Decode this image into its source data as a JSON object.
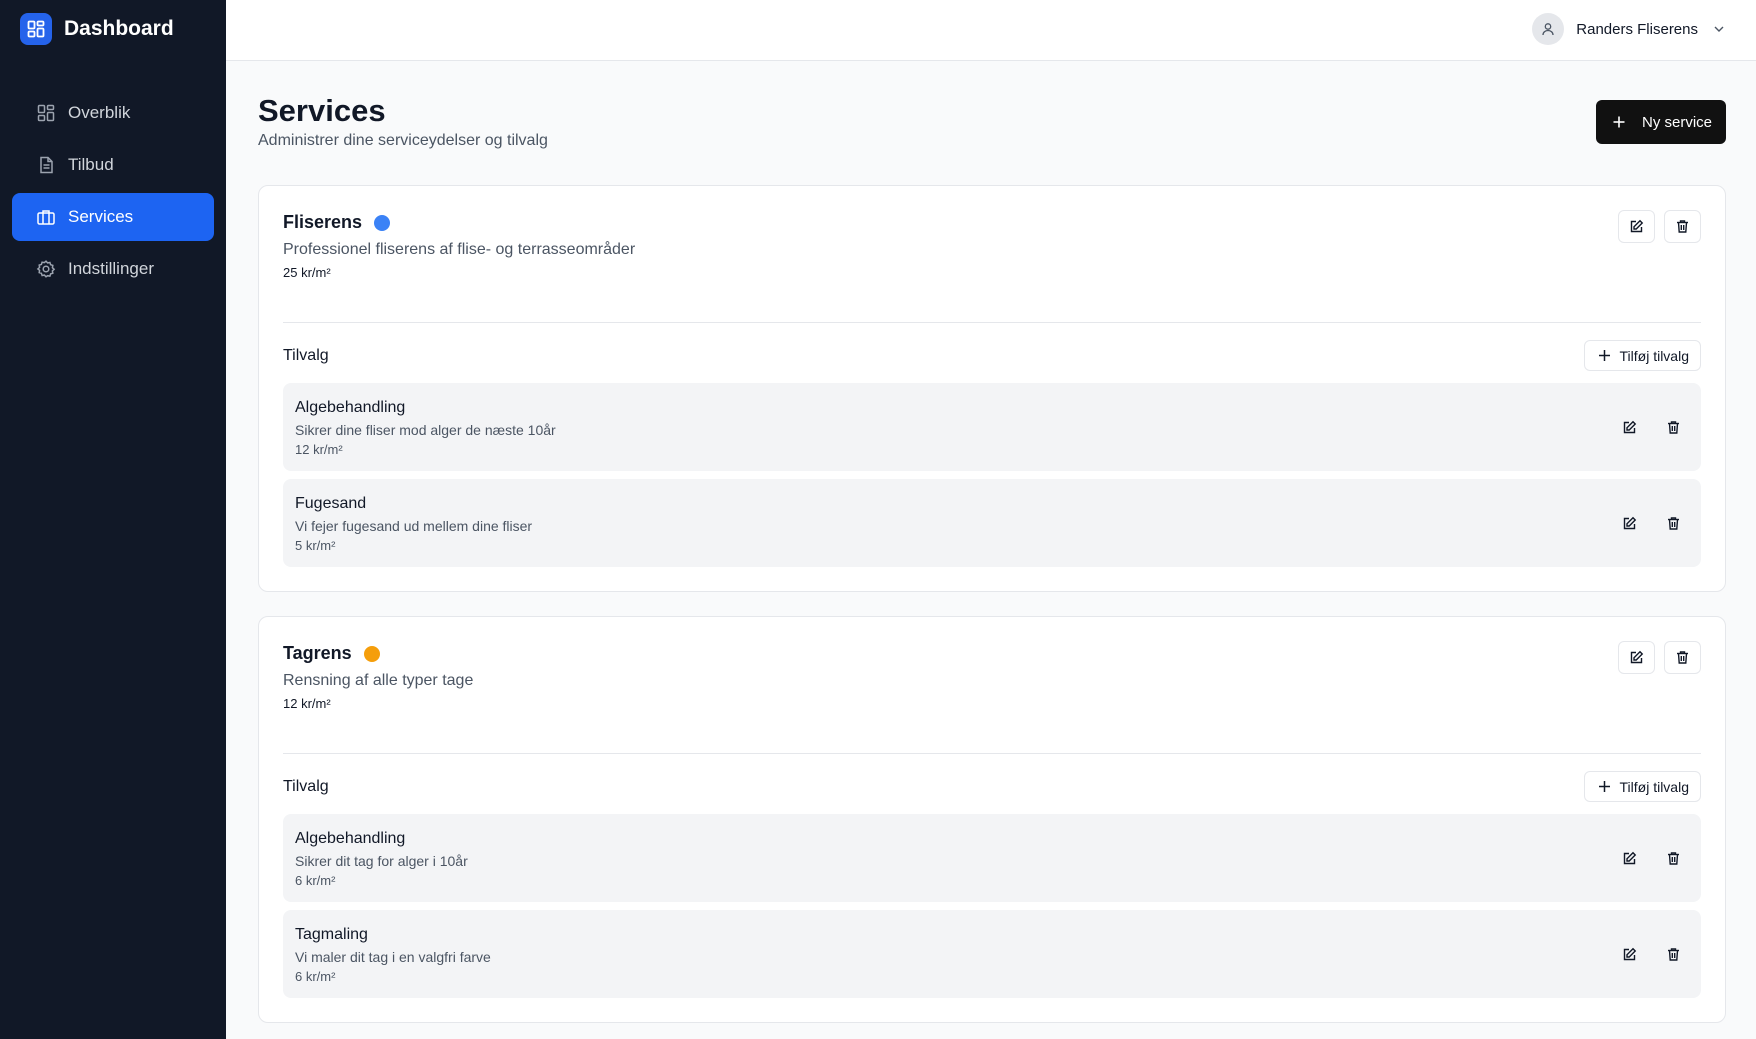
{
  "app": {
    "title": "Dashboard"
  },
  "sidebar": {
    "items": [
      {
        "label": "Overblik",
        "icon": "grid-icon",
        "active": false
      },
      {
        "label": "Tilbud",
        "icon": "document-icon",
        "active": false
      },
      {
        "label": "Services",
        "icon": "briefcase-icon",
        "active": true
      },
      {
        "label": "Indstillinger",
        "icon": "gear-icon",
        "active": false
      }
    ]
  },
  "header": {
    "user_name": "Randers Fliserens"
  },
  "page": {
    "title": "Services",
    "subtitle": "Administrer dine serviceydelser og tilvalg",
    "new_button_label": "Ny service"
  },
  "services": [
    {
      "name": "Fliserens",
      "color": "#3b82f6",
      "description": "Professionel fliserens af flise- og terrasseområder",
      "price": "25 kr/m²",
      "addons_title": "Tilvalg",
      "add_addon_label": "Tilføj tilvalg",
      "addons": [
        {
          "name": "Algebehandling",
          "description": "Sikrer dine fliser mod alger de næste 10år",
          "price": "12 kr/m²"
        },
        {
          "name": "Fugesand",
          "description": "Vi fejer fugesand ud mellem dine fliser",
          "price": "5 kr/m²"
        }
      ]
    },
    {
      "name": "Tagrens",
      "color": "#f59e0b",
      "description": "Rensning af alle typer tage",
      "price": "12 kr/m²",
      "addons_title": "Tilvalg",
      "add_addon_label": "Tilføj tilvalg",
      "addons": [
        {
          "name": "Algebehandling",
          "description": "Sikrer dit tag for alger i 10år",
          "price": "6 kr/m²"
        },
        {
          "name": "Tagmaling",
          "description": "Vi maler dit tag i en valgfri farve",
          "price": "6 kr/m²"
        }
      ]
    }
  ]
}
